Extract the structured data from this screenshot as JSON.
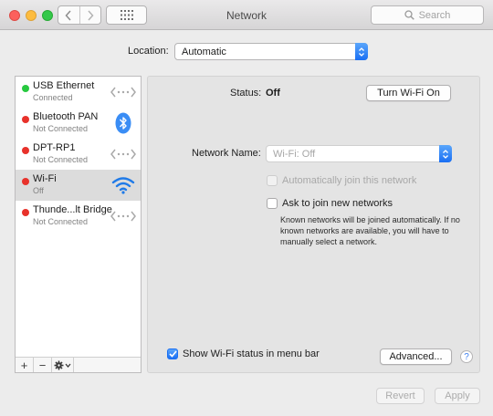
{
  "window": {
    "title": "Network",
    "search_placeholder": "Search"
  },
  "location": {
    "label": "Location:",
    "value": "Automatic"
  },
  "services": [
    {
      "name": "USB Ethernet",
      "status": "Connected",
      "status_color": "#27c93f",
      "icon": "ethernet-arrows-icon"
    },
    {
      "name": "Bluetooth PAN",
      "status": "Not Connected",
      "status_color": "#e8322b",
      "icon": "bluetooth-icon"
    },
    {
      "name": "DPT-RP1",
      "status": "Not Connected",
      "status_color": "#e8322b",
      "icon": "ethernet-arrows-icon"
    },
    {
      "name": "Wi-Fi",
      "status": "Off",
      "status_color": "#e8322b",
      "icon": "wifi-icon",
      "selected": true
    },
    {
      "name": "Thunde...lt Bridge",
      "status": "Not Connected",
      "status_color": "#e8322b",
      "icon": "ethernet-arrows-icon"
    }
  ],
  "sidebar_controls": {
    "add": "+",
    "remove": "−",
    "actions": "gear-icon"
  },
  "detail": {
    "status_label": "Status:",
    "status_value": "Off",
    "turn_button": "Turn Wi-Fi On",
    "network_name_label": "Network Name:",
    "network_name_value": "Wi-Fi: Off",
    "auto_join_label": "Automatically join this network",
    "auto_join_checked": false,
    "auto_join_enabled": false,
    "ask_join_label": "Ask to join new networks",
    "ask_join_checked": false,
    "ask_join_note": "Known networks will be joined automatically. If no known networks are available, you will have to manually select a network.",
    "show_status_label": "Show Wi-Fi status in menu bar",
    "show_status_checked": true,
    "advanced_button": "Advanced...",
    "help_button": "?"
  },
  "footer": {
    "revert_button": "Revert",
    "apply_button": "Apply"
  },
  "colors": {
    "accent": "#1a6ff3",
    "status_connected": "#27c93f",
    "status_off": "#e8322b"
  }
}
